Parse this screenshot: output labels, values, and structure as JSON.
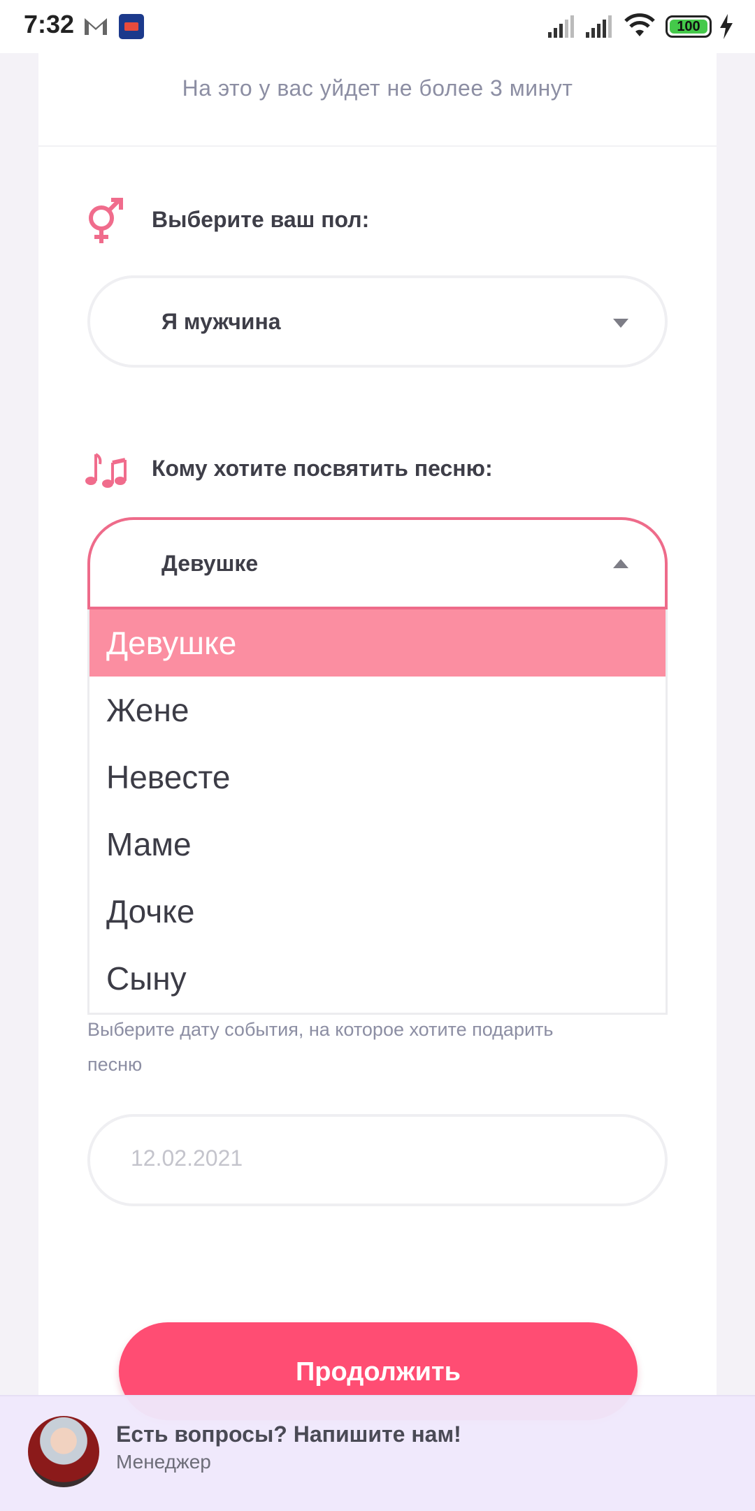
{
  "status_bar": {
    "time": "7:32",
    "battery": "100",
    "icons": [
      "gmail-icon",
      "app-notification-icon",
      "signal-icon",
      "signal-icon",
      "wifi-icon",
      "battery-icon",
      "charging-bolt-icon"
    ]
  },
  "form": {
    "subtitle": "На это у вас уйдет не более 3 минут",
    "gender": {
      "icon": "gender-icon",
      "label": "Выберите ваш пол:",
      "value": "Я мужчина"
    },
    "recipient": {
      "icon": "music-notes-icon",
      "label": "Кому хотите посвятить песню:",
      "value": "Девушке",
      "options": [
        "Девушке",
        "Жене",
        "Невесте",
        "Маме",
        "Дочке",
        "Сыну"
      ],
      "selected_index": 0
    },
    "date": {
      "hint": "Выберите дату события, на которое хотите подарить песню",
      "placeholder": "12.02.2021"
    },
    "continue_label": "Продолжить"
  },
  "chat_widget": {
    "title": "Есть вопросы? Напишите нам!",
    "subtitle": "Менеджер"
  },
  "colors": {
    "accent": "#ff4d73",
    "selected_option": "#fb8ea1",
    "open_border": "#ee6b8a",
    "icon_pink": "#f06c8c",
    "chat_bg": "#efe8fc"
  }
}
